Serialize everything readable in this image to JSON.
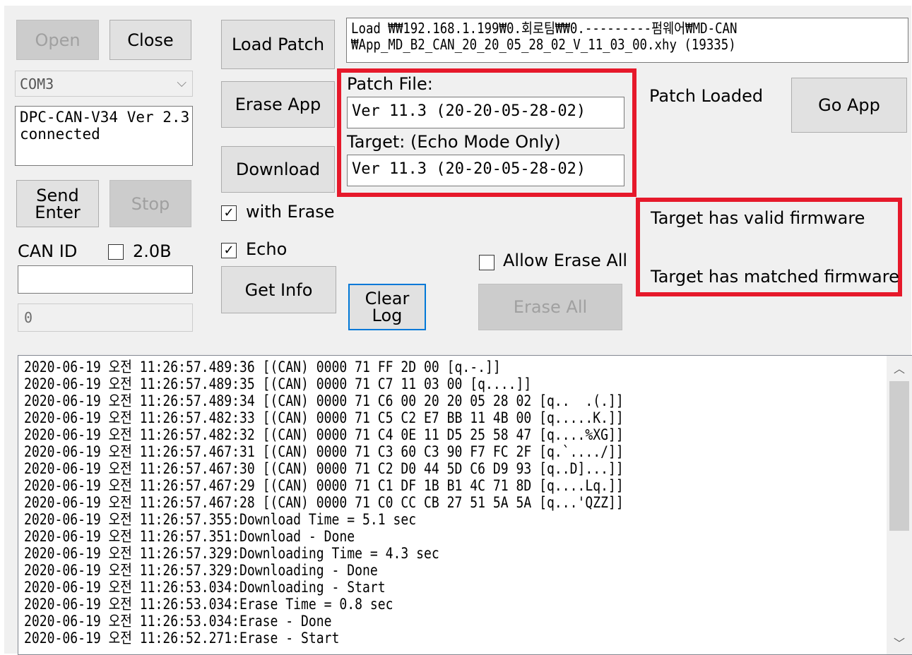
{
  "buttons": {
    "open": "Open",
    "close": "Close",
    "load_patch": "Load Patch",
    "erase_app": "Erase App",
    "download": "Download",
    "get_info": "Get Info",
    "send_enter": "Send\nEnter",
    "stop": "Stop",
    "clear_log": "Clear\nLog",
    "erase_all": "Erase All",
    "go_app": "Go App"
  },
  "port": {
    "selected": "COM3"
  },
  "device_status": "DPC-CAN-V34 Ver 2.3\nconnected",
  "patch_path": "Load ₩₩192.168.1.199₩0.회로팀₩₩0.---------펌웨어₩MD-CAN\n₩App_MD_B2_CAN_20_20_05_28_02_V_11_03_00.xhy (19335)",
  "patch_file": {
    "label": "Patch File:",
    "value": "Ver 11.3 (20-20-05-28-02)"
  },
  "target": {
    "label": "Target: (Echo Mode Only)",
    "value": "Ver 11.3 (20-20-05-28-02)"
  },
  "patch_loaded": "Patch Loaded",
  "firmware_status": {
    "valid": "Target has valid firmware",
    "matched": "Target has matched firmware"
  },
  "options": {
    "with_erase": {
      "label": "with Erase",
      "checked": true
    },
    "echo": {
      "label": "Echo",
      "checked": true
    },
    "allow_erase_all": {
      "label": "Allow Erase All",
      "checked": false
    },
    "can_20b": {
      "label": "2.0B",
      "checked": false
    }
  },
  "can_id": {
    "label": "CAN ID",
    "value": ""
  },
  "counter_value": "0",
  "log_lines": [
    "2020-06-19 오전 11:26:57.489:36 [(CAN) 0000 71 FF 2D 00 [q.-.]]",
    "2020-06-19 오전 11:26:57.489:35 [(CAN) 0000 71 C7 11 03 00 [q....]]",
    "2020-06-19 오전 11:26:57.489:34 [(CAN) 0000 71 C6 00 20 20 05 28 02 [q..  .(.]]",
    "2020-06-19 오전 11:26:57.482:33 [(CAN) 0000 71 C5 C2 E7 BB 11 4B 00 [q.....K.]]",
    "2020-06-19 오전 11:26:57.482:32 [(CAN) 0000 71 C4 0E 11 D5 25 58 47 [q....%XG]]",
    "2020-06-19 오전 11:26:57.467:31 [(CAN) 0000 71 C3 60 C3 90 F7 FC 2F [q.`..../]]",
    "2020-06-19 오전 11:26:57.467:30 [(CAN) 0000 71 C2 D0 44 5D C6 D9 93 [q..D]...]]",
    "2020-06-19 오전 11:26:57.467:29 [(CAN) 0000 71 C1 DF 1B B1 4C 71 8D [q....Lq.]]",
    "2020-06-19 오전 11:26:57.467:28 [(CAN) 0000 71 C0 CC CB 27 51 5A 5A [q...'QZZ]]",
    "2020-06-19 오전 11:26:57.355:Download Time = 5.1 sec",
    "2020-06-19 오전 11:26:57.351:Download - Done",
    "2020-06-19 오전 11:26:57.329:Downloading Time = 4.3 sec",
    "2020-06-19 오전 11:26:57.329:Downloading - Done",
    "2020-06-19 오전 11:26:53.034:Downloading - Start",
    "2020-06-19 오전 11:26:53.034:Erase Time = 0.8 sec",
    "2020-06-19 오전 11:26:53.034:Erase - Done",
    "2020-06-19 오전 11:26:52.271:Erase - Start"
  ],
  "icons": {
    "dropdown": "chevron-down-icon",
    "scroll_up": "scroll-up-arrow-icon",
    "scroll_down": "scroll-down-arrow-icon"
  },
  "colors": {
    "highlight_box": "#e6192b",
    "focus_border": "#0078d7"
  }
}
